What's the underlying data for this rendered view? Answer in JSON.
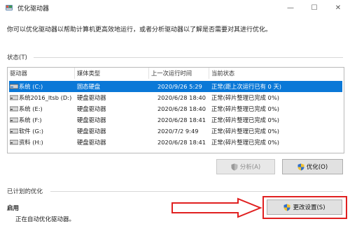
{
  "window": {
    "title": "优化驱动器",
    "minimize": "—",
    "maximize": "☐",
    "close": "✕"
  },
  "description": "你可以优化驱动器以帮助计算机更高效地运行，或者分析驱动器以了解是否需要对其进行优化。",
  "status_group": {
    "label": "状态(T)"
  },
  "list": {
    "columns": [
      "驱动器",
      "媒体类型",
      "上一次运行时间",
      "当前状态"
    ],
    "rows": [
      {
        "drive": "系统 (C:)",
        "media": "固态硬盘",
        "last_run": "2020/9/26 5:29",
        "status": "正常(距上次运行已有 0 天)",
        "selected": true
      },
      {
        "drive": "系统2016_ltsb (D:)",
        "media": "硬盘驱动器",
        "last_run": "2020/6/28 18:40",
        "status": "正常(碎片整理已完成 0%)",
        "selected": false
      },
      {
        "drive": "系统 (E:)",
        "media": "硬盘驱动器",
        "last_run": "2020/6/28 18:40",
        "status": "正常(碎片整理已完成 0%)",
        "selected": false
      },
      {
        "drive": "系统 (F:)",
        "media": "硬盘驱动器",
        "last_run": "2020/6/28 18:41",
        "status": "正常(碎片整理已完成 0%)",
        "selected": false
      },
      {
        "drive": "软件 (G:)",
        "media": "硬盘驱动器",
        "last_run": "2020/7/2 9:49",
        "status": "正常(碎片整理已完成 0%)",
        "selected": false
      },
      {
        "drive": "资料 (H:)",
        "media": "硬盘驱动器",
        "last_run": "2020/6/28 18:41",
        "status": "正常(碎片整理已完成 0%)",
        "selected": false
      }
    ]
  },
  "buttons": {
    "analyze": "分析(A)",
    "optimize": "优化(O)",
    "change_settings": "更改设置(S)"
  },
  "scheduled": {
    "group_label": "已计划的优化",
    "title": "启用",
    "status": "正在自动优化驱动器。"
  },
  "colors": {
    "selection": "#0a78d7",
    "annotation_arrow": "#e02020",
    "annotation_box": "#e02020"
  }
}
